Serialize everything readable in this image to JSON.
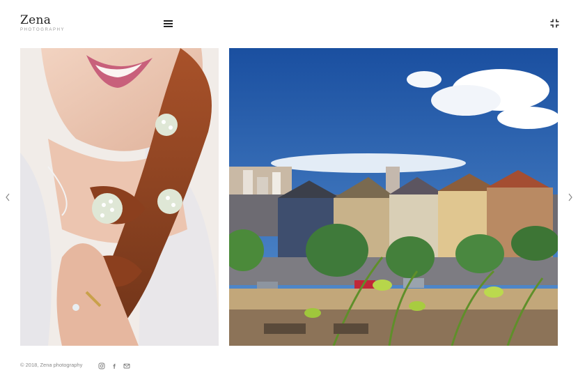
{
  "brand": {
    "title": "Zena",
    "subtitle": "PHOTOGRAPHY"
  },
  "header": {
    "menu_icon": "hamburger-menu-icon",
    "fullscreen_icon": "collapse-fullscreen-icon"
  },
  "slider": {
    "prev_icon": "chevron-left-icon",
    "next_icon": "chevron-right-icon",
    "slides": [
      {
        "subject": "bride-braided-hair-with-flowers"
      },
      {
        "subject": "painted-ladies-houses-city-skyline"
      }
    ]
  },
  "footer": {
    "copyright": "© 2018, Zena photography",
    "social": [
      "instagram-icon",
      "facebook-icon",
      "mail-icon"
    ]
  },
  "colors": {
    "text": "#222222",
    "muted": "#8a8a8a",
    "sky": "#1f5fae"
  }
}
